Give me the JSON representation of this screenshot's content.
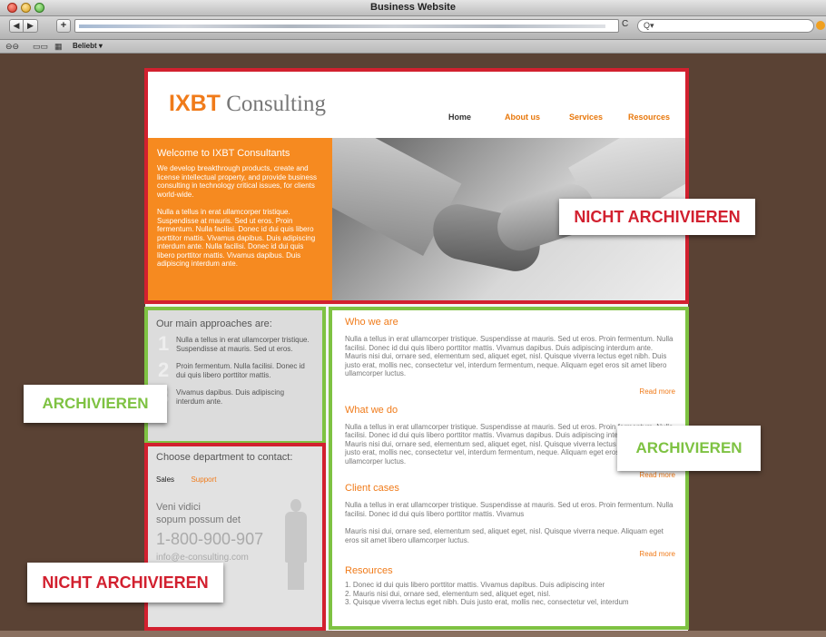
{
  "browser": {
    "window_title": "Business Website",
    "back_glyph": "◀",
    "forward_glyph": "▶",
    "add_glyph": "+",
    "reload_glyph": "C",
    "search_placeholder": "Q▾",
    "bookmarks_label": "Beliebt ▾",
    "icons": [
      "reader-icon",
      "bookmarks-book-icon",
      "top-sites-grid-icon"
    ]
  },
  "site": {
    "logo_brand": "IXBT",
    "logo_text": " Consulting",
    "nav": [
      {
        "label": "Home",
        "active": true
      },
      {
        "label": "About us",
        "active": false
      },
      {
        "label": "Services",
        "active": false
      },
      {
        "label": "Resources",
        "active": false
      }
    ],
    "welcome": {
      "title": "Welcome to IXBT Consultants",
      "para1": "We develop breakthrough products, create and license intellectual property, and provide business consulting in technology critical issues, for clients world-wide.",
      "para2": "Nulla a tellus in erat ullamcorper tristique. Suspendisse at mauris. Sed ut eros. Proin fermentum. Nulla facilisi. Donec id dui quis libero porttitor mattis. Vivamus dapibus. Duis adipiscing interdum ante. Nulla facilisi. Donec id dui quis libero porttitor mattis. Vivamus dapibus. Duis adipiscing interdum ante."
    },
    "approaches": {
      "title": "Our main approaches are:",
      "items": [
        {
          "num": "1",
          "text": "Nulla a tellus in erat ullamcorper tristique. Suspendisse at mauris. Sed ut eros."
        },
        {
          "num": "2",
          "text": "Proin fermentum. Nulla facilisi. Donec id dui quis libero porttitor mattis."
        },
        {
          "num": "3",
          "text": "Vivamus dapibus. Duis adipiscing interdum ante."
        }
      ]
    },
    "contact": {
      "title": "Choose department to contact:",
      "tab_sales": "Sales",
      "tab_support": "Support",
      "line1": "Veni vidici",
      "line2": "sopum possum det",
      "phone": "1-800-900-907",
      "email": "info@e-consulting.com"
    },
    "sections": [
      {
        "title": "Who we are",
        "body": "Nulla a tellus in erat ullamcorper tristique. Suspendisse at mauris. Sed ut eros. Proin fermentum. Nulla facilisi. Donec id dui quis libero porttitor mattis. Vivamus dapibus. Duis adipiscing interdum ante. Mauris nisi dui, ornare sed, elementum sed, aliquet eget, nisl. Quisque viverra lectus eget nibh. Duis justo erat, mollis nec, consectetur vel, interdum fermentum, neque. Aliquam eget eros sit amet libero ullamcorper luctus.",
        "read_more": "Read more"
      },
      {
        "title": "What we do",
        "body": "Nulla a tellus in erat ullamcorper tristique. Suspendisse at mauris. Sed ut eros. Proin fermentum. Nulla facilisi. Donec id dui quis libero porttitor mattis. Vivamus dapibus. Duis adipiscing interdum ante. Mauris nisi dui, ornare sed, elementum sed, aliquet eget, nisl. Quisque viverra lectus eget nibh. Duis justo erat, mollis nec, consectetur vel, interdum fermentum, neque. Aliquam eget eros sit amet libero ullamcorper luctus.",
        "read_more": "Read more"
      },
      {
        "title": "Client cases",
        "body": "Nulla a tellus in erat ullamcorper tristique. Suspendisse at mauris. Sed ut eros. Proin fermentum. Nulla facilisi. Donec id dui quis libero porttitor mattis. Vivamus",
        "body2": "Mauris nisi dui, ornare sed, elementum sed, aliquet eget, nisl. Quisque viverra neque. Aliquam eget eros sit amet libero ullamcorper luctus.",
        "read_more": "Read more"
      }
    ],
    "resources": {
      "title": "Resources",
      "items": [
        "1. Donec id dui quis libero porttitor mattis. Vivamus dapibus. Duis adipiscing inter",
        "2. Mauris nisi dui, ornare sed, elementum sed, aliquet eget, nisl.",
        "3. Quisque viverra lectus eget nibh. Duis justo erat, mollis nec, consectetur vel, interdum"
      ]
    }
  },
  "overlays": {
    "red_label": "NICHT ARCHIVIEREN",
    "green_label": "ARCHIVIEREN",
    "red_color": "#d2202f",
    "green_color": "#7ec242"
  }
}
